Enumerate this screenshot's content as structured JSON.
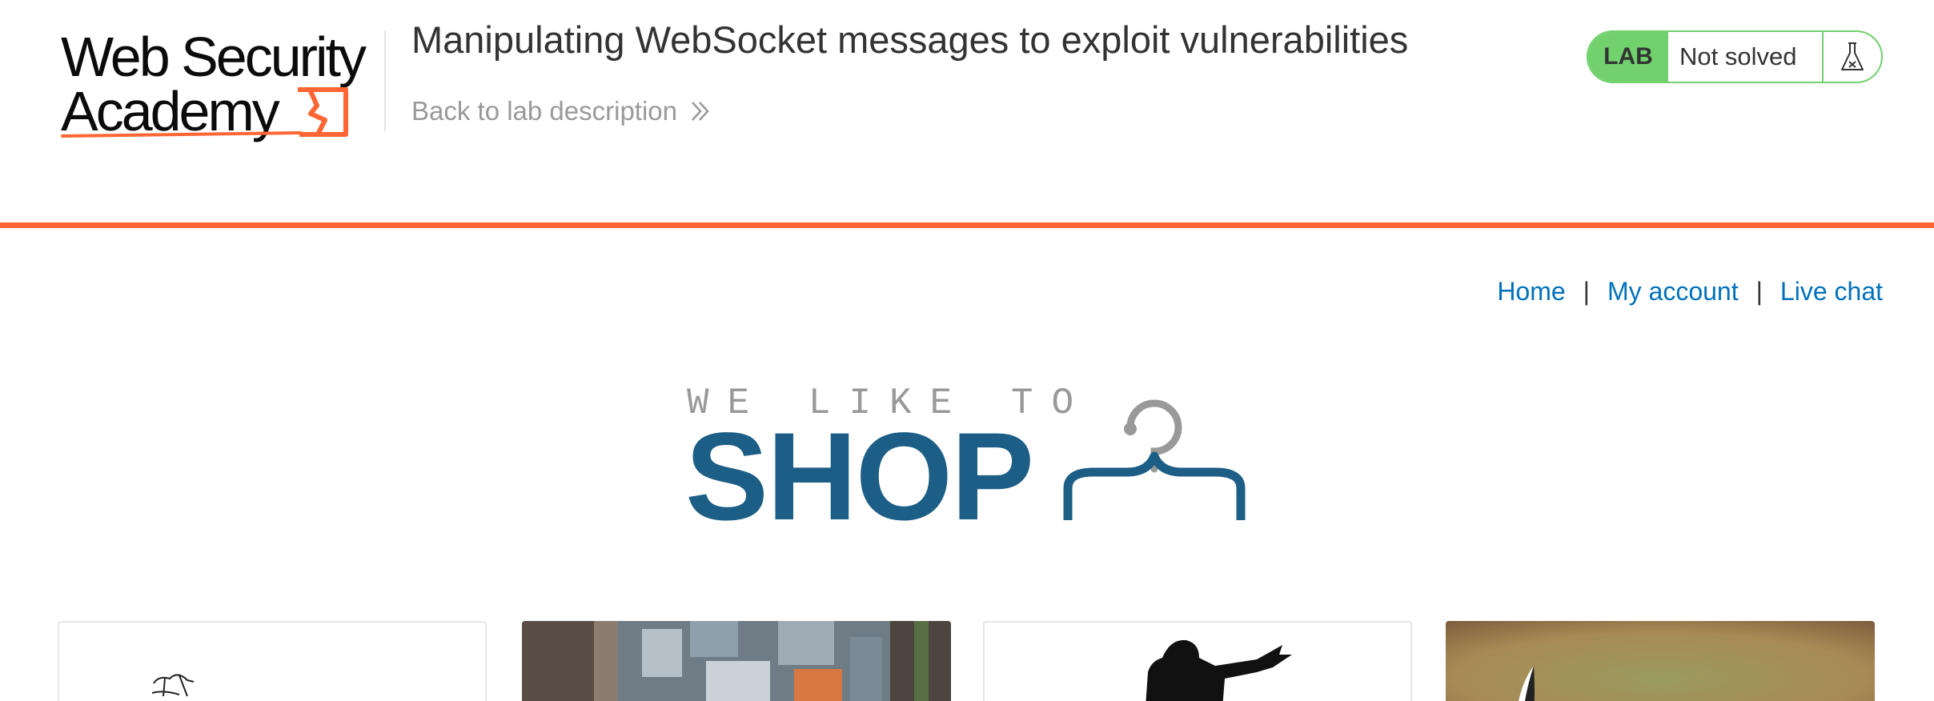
{
  "header": {
    "logo_line1": "Web Security",
    "logo_line2": "Academy",
    "lab_title": "Manipulating WebSocket messages to exploit vulnerabilities",
    "back_link": "Back to lab description",
    "lab_badge": "LAB",
    "lab_status": "Not solved"
  },
  "nav": {
    "home": "Home",
    "my_account": "My account",
    "live_chat": "Live chat",
    "separator": "|"
  },
  "banner": {
    "top_text": "WE LIKE TO",
    "main_text": "SHOP"
  },
  "colors": {
    "accent_orange": "#ff6633",
    "lab_green": "#70d16d",
    "link_blue": "#0071bc",
    "shop_blue": "#1c5e85"
  },
  "icons": [
    "logo-mark-icon",
    "chevrons-right-icon",
    "flask-icon",
    "hanger-icon"
  ]
}
